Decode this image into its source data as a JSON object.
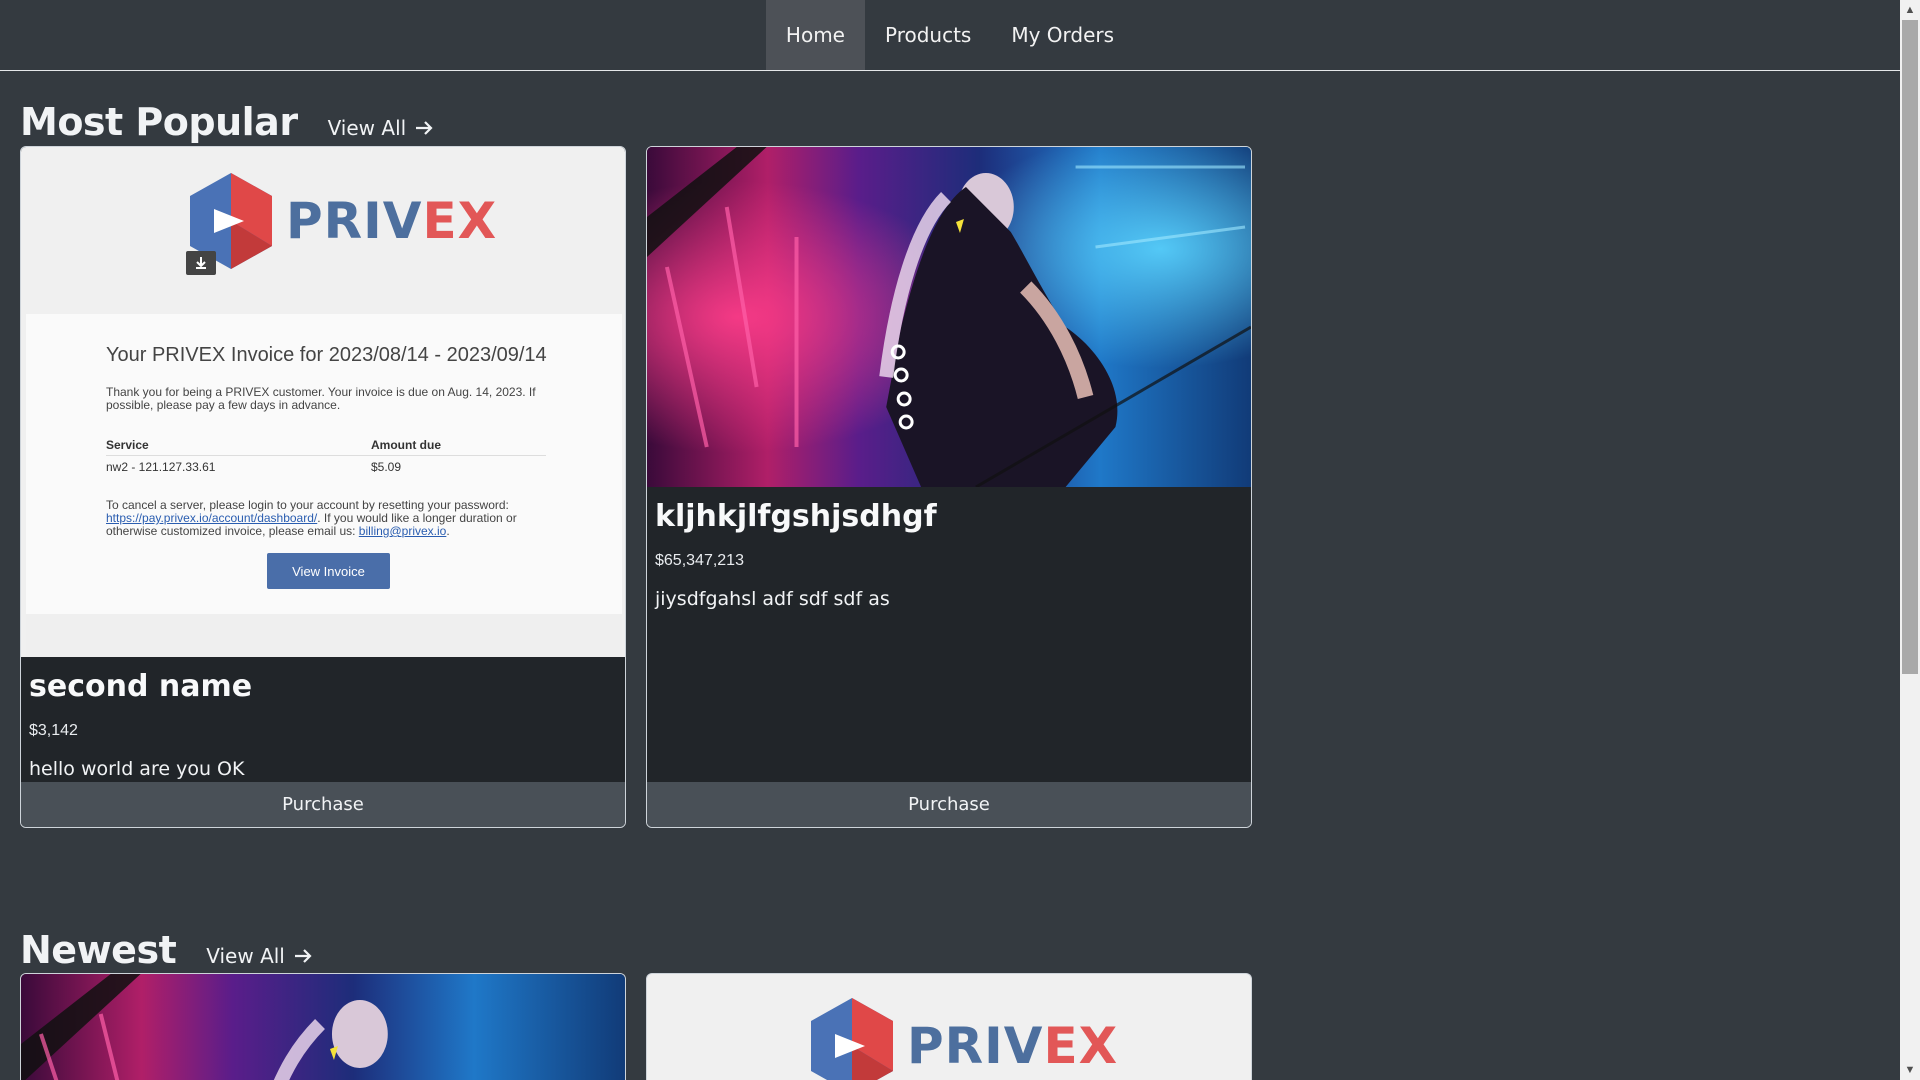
{
  "nav": {
    "items": [
      {
        "label": "Home",
        "active": true
      },
      {
        "label": "Products",
        "active": false
      },
      {
        "label": "My Orders",
        "active": false
      }
    ]
  },
  "sections": {
    "popular": {
      "title": "Most Popular",
      "view_all": "View All"
    },
    "newest": {
      "title": "Newest",
      "view_all": "View All"
    }
  },
  "popular_cards": [
    {
      "title": "second name",
      "price": "$3,142",
      "description": "hello world are you OK",
      "purchase": "Purchase",
      "image": "privex-invoice"
    },
    {
      "title": "kljhkjlfgshjsdhgf",
      "price": "$65,347,213",
      "description": "jiysdfgahsl adf sdf sdf as",
      "purchase": "Purchase",
      "image": "cyberpunk-art"
    }
  ],
  "invoice": {
    "logo_part1": "PRIV",
    "logo_part2": "EX",
    "title": "Your PRIVEX Invoice for 2023/08/14 - 2023/09/14",
    "intro": "Thank you for being a PRIVEX customer. Your invoice is due on Aug. 14, 2023. If possible, please pay a few days in advance.",
    "col_service": "Service",
    "col_amount": "Amount due",
    "row_service": "nw2 - 121.127.33.61",
    "row_amount": "$5.09",
    "cancel_text": "To cancel a server, please login to your account by resetting your password:",
    "link1": "https://pay.privex.io/account/dashboard/",
    "mid_text": ". If you would like a longer duration or otherwise customized invoice, please email us:",
    "link2": "billing@privex.io",
    "button": "View Invoice"
  },
  "colors": {
    "background": "#343a40",
    "card": "#212529",
    "button": "#495057",
    "nav_active": "#4d5157"
  }
}
